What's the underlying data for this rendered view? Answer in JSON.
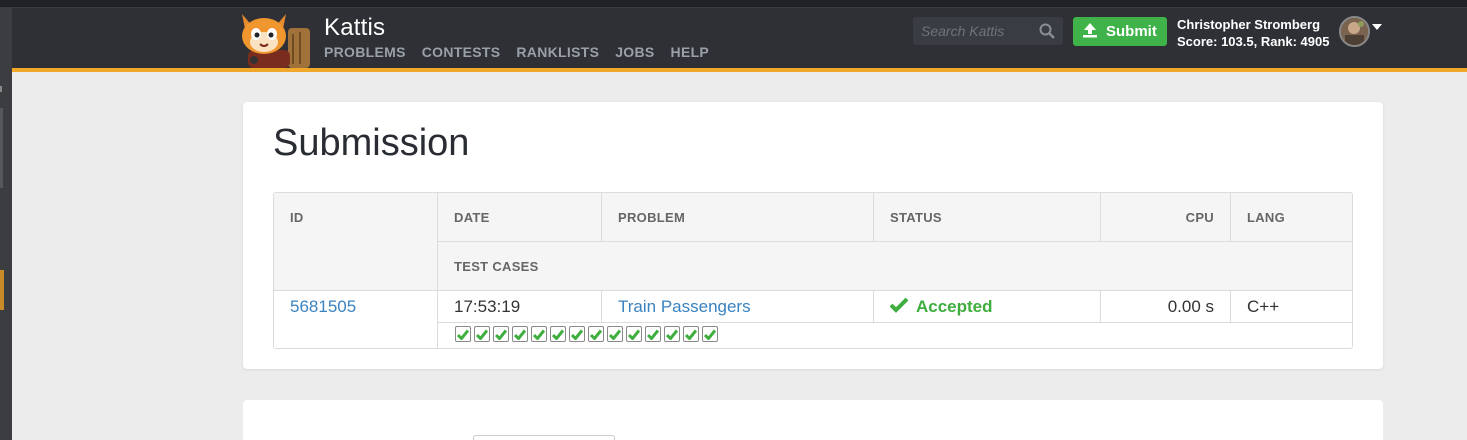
{
  "brand": {
    "name": "Kattis"
  },
  "nav": [
    "PROBLEMS",
    "CONTESTS",
    "RANKLISTS",
    "JOBS",
    "HELP"
  ],
  "search": {
    "placeholder": "Search Kattis"
  },
  "submit_label": "Submit",
  "user": {
    "name": "Christopher Stromberg",
    "stats": "Score: 103.5, Rank: 4905"
  },
  "page_title": "Submission",
  "table": {
    "headers": {
      "id": "ID",
      "date": "DATE",
      "problem": "PROBLEM",
      "status": "STATUS",
      "cpu": "CPU",
      "lang": "LANG",
      "test_cases": "TEST CASES"
    },
    "row": {
      "id": "5681505",
      "date": "17:53:19",
      "problem": "Train Passengers",
      "status": "Accepted",
      "cpu": "0.00 s",
      "lang": "C++"
    },
    "test_cases_passed": 14
  },
  "colors": {
    "accent": "#f0a82a",
    "success": "#3fb34a",
    "link": "#3a83c1",
    "navbar": "#2e3036"
  },
  "icons": {
    "search": "search-icon",
    "upload": "upload-icon",
    "check": "check-icon"
  }
}
